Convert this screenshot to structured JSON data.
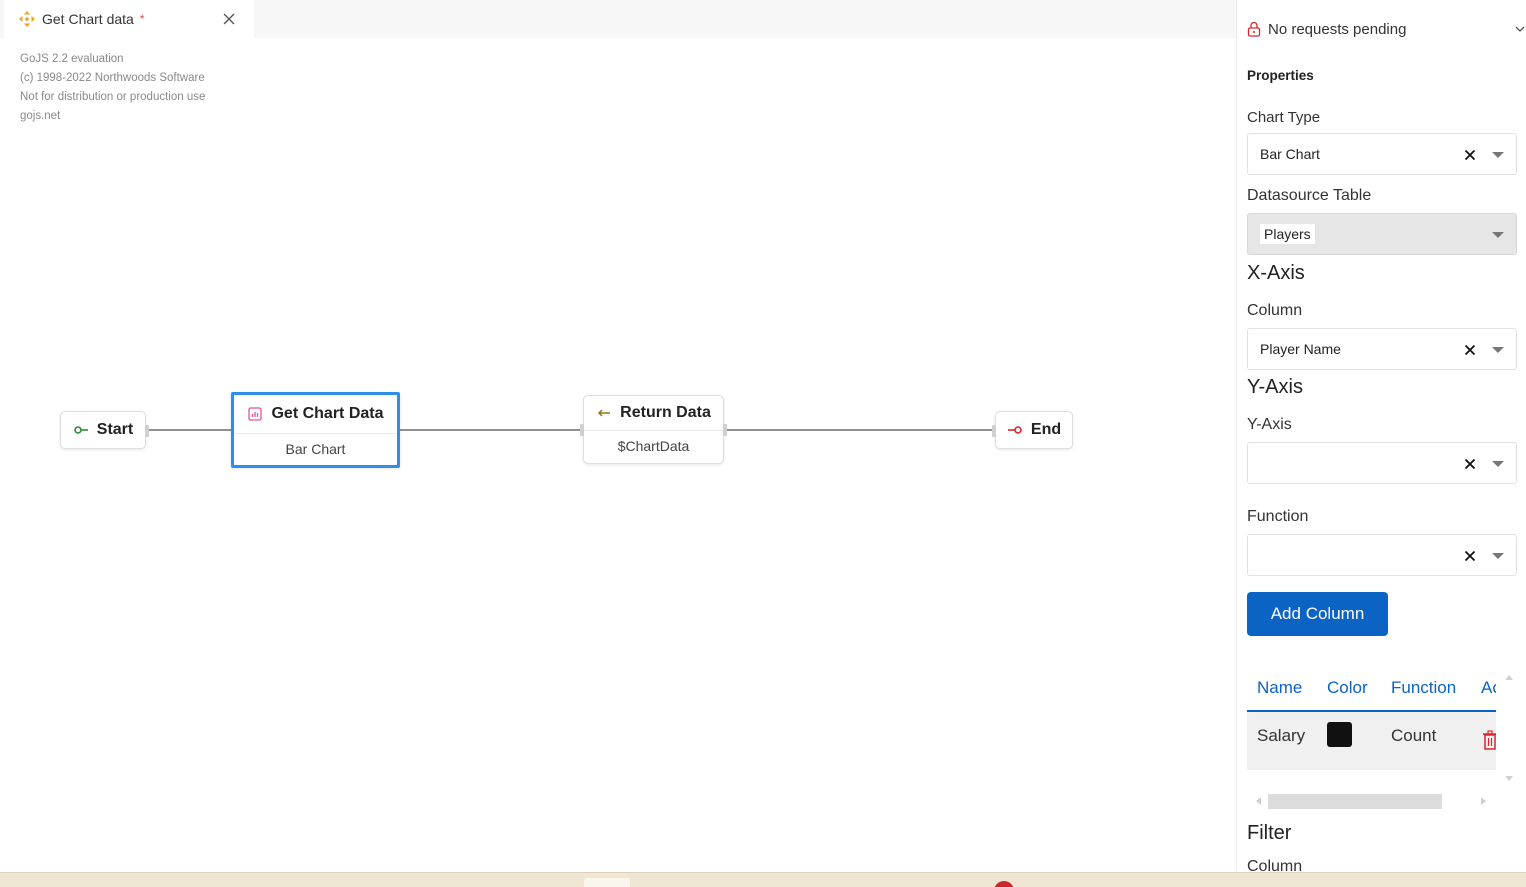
{
  "tab": {
    "title": "Get Chart data",
    "dirty_marker": "*",
    "icon": "move-arrows-icon",
    "close_icon": "close-icon"
  },
  "watermark": {
    "lines": [
      "GoJS 2.2 evaluation",
      "(c) 1998-2022 Northwoods Software",
      "Not for distribution or production use",
      "gojs.net"
    ]
  },
  "diagram": {
    "nodes": {
      "start": {
        "label": "Start",
        "icon": "start-connector-icon"
      },
      "get_chart": {
        "label": "Get Chart Data",
        "sub": "Bar Chart",
        "icon": "chart-icon"
      },
      "return_data": {
        "label": "Return Data",
        "sub": "$ChartData",
        "icon": "return-arrow-icon"
      },
      "end": {
        "label": "End",
        "icon": "end-connector-icon"
      }
    },
    "colors": {
      "selection": "#2d8ef0",
      "start_icon": "#2e8b3a",
      "end_icon": "#d9272e",
      "chart_icon": "#e0559a",
      "return_icon": "#8a7a1e"
    }
  },
  "panel": {
    "status": "No requests pending",
    "properties_title": "Properties",
    "chart_type": {
      "label": "Chart Type",
      "value": "Bar Chart"
    },
    "datasource": {
      "label": "Datasource Table",
      "value": "Players"
    },
    "x_axis": {
      "heading": "X-Axis",
      "column_label": "Column",
      "column_value": "Player Name"
    },
    "y_axis": {
      "heading": "Y-Axis",
      "label": "Y-Axis",
      "value": ""
    },
    "function": {
      "label": "Function",
      "value": ""
    },
    "add_column": "Add Column",
    "table": {
      "headers": [
        "Name",
        "Color",
        "Function",
        "Ac"
      ],
      "rows": [
        {
          "name": "Salary",
          "color": "#111111",
          "function": "Count"
        }
      ]
    },
    "filter": {
      "heading": "Filter",
      "column_label": "Column"
    },
    "accent": "#0b63c4",
    "delete_color": "#d9272e"
  }
}
